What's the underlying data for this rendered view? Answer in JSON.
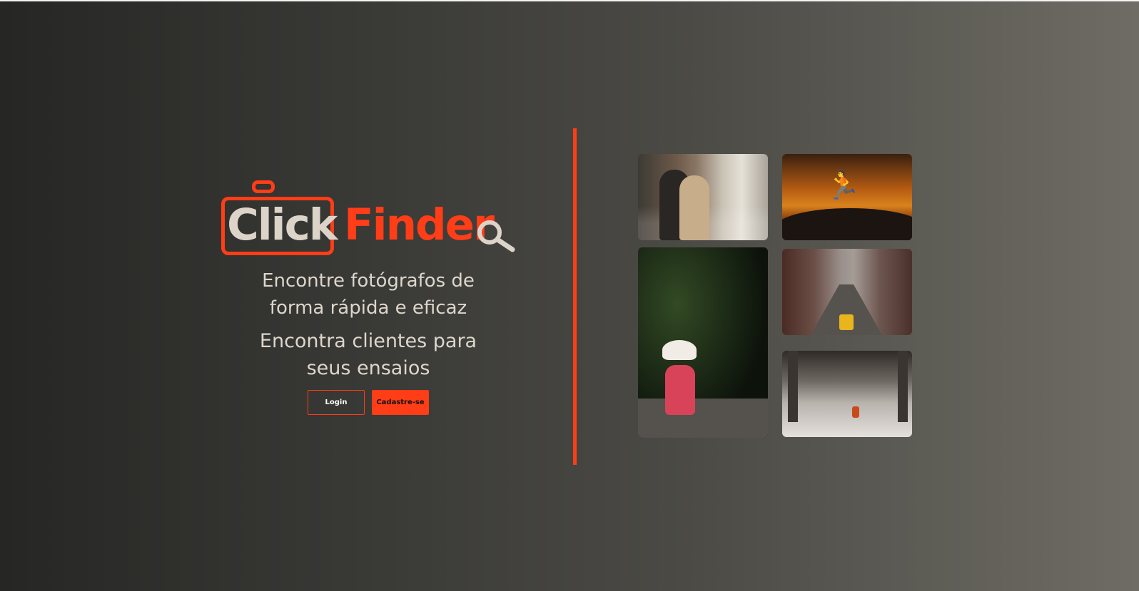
{
  "brand": {
    "name_part1": "Click",
    "name_part2": "Finder",
    "accent_color": "#ff3d17",
    "text_color": "#dcd4c8"
  },
  "hero": {
    "tagline_line1": "Encontre fotógrafos de",
    "tagline_line2": "forma rápida e eficaz",
    "subtagline_line1": "Encontra clientes para",
    "subtagline_line2": "seus ensaios"
  },
  "buttons": {
    "login_label": "Login",
    "signup_label": "Cadastre-se"
  },
  "gallery": {
    "photos": [
      {
        "name": "photo-couple-market"
      },
      {
        "name": "photo-jump-sunset"
      },
      {
        "name": "photo-girl-red-dress"
      },
      {
        "name": "photo-city-traffic"
      },
      {
        "name": "photo-snow-temple"
      }
    ]
  },
  "icons": {
    "logo_camera": "camera-icon",
    "logo_magnifier": "magnifier-icon"
  }
}
